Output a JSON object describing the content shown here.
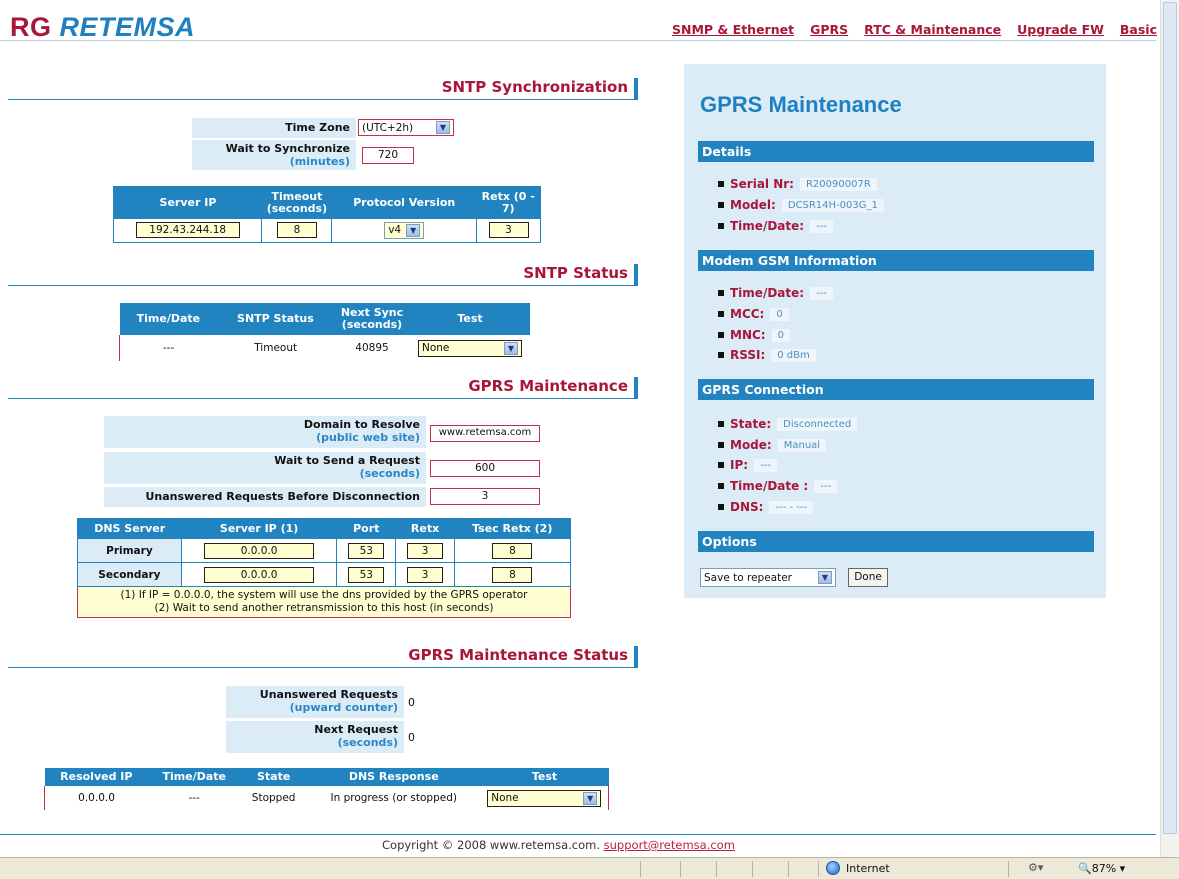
{
  "header": {
    "logo_rg": "RG",
    "logo_name": "RETEMSA",
    "nav": [
      "SNMP & Ethernet",
      "GPRS",
      "RTC & Maintenance",
      "Upgrade FW",
      "Basic"
    ]
  },
  "sntp": {
    "title": "SNTP Synchronization",
    "time_zone_label": "Time Zone",
    "time_zone_value": "(UTC+2h)",
    "wait_label": "Wait to Synchronize",
    "wait_sub": "(minutes)",
    "wait_value": "720",
    "table_headers": [
      "Server IP",
      "Timeout (seconds)",
      "Protocol Version",
      "Retx (0 - 7)"
    ],
    "server_ip": "192.43.244.18",
    "timeout": "8",
    "protocol": "v4",
    "retx": "3"
  },
  "sntp_status": {
    "title": "SNTP Status",
    "headers": [
      "Time/Date",
      "SNTP Status",
      "Next Sync (seconds)",
      "Test"
    ],
    "time_date": "---",
    "status": "Timeout",
    "next_sync": "40895",
    "test": "None"
  },
  "gprs_maint": {
    "title": "GPRS Maintenance",
    "domain_label": "Domain to Resolve",
    "domain_sub": "(public web site)",
    "domain_value": "www.retemsa.com",
    "wait_req_label": "Wait to Send a Request",
    "wait_req_sub": "(seconds)",
    "wait_req_value": "600",
    "unans_label": "Unanswered Requests Before Disconnection",
    "unans_value": "3",
    "dns_headers": [
      "DNS Server",
      "Server IP (1)",
      "Port",
      "Retx",
      "Tsec Retx (2)"
    ],
    "dns_rows": [
      {
        "name": "Primary",
        "ip": "0.0.0.0",
        "port": "53",
        "retx": "3",
        "tsec": "8"
      },
      {
        "name": "Secondary",
        "ip": "0.0.0.0",
        "port": "53",
        "retx": "3",
        "tsec": "8"
      }
    ],
    "note1": "(1) If IP = 0.0.0.0, the system will use the dns provided by the GPRS operator",
    "note2": "(2) Wait to send another retransmission to this host (in seconds)"
  },
  "gprs_status": {
    "title": "GPRS Maintenance Status",
    "unans_label": "Unanswered Requests",
    "unans_sub": "(upward counter)",
    "unans_value": "0",
    "next_label": "Next Request",
    "next_sub": "(seconds)",
    "next_value": "0",
    "headers": [
      "Resolved IP",
      "Time/Date",
      "State",
      "DNS Response",
      "Test"
    ],
    "resolved_ip": "0.0.0.0",
    "time_date": "---",
    "state": "Stopped",
    "dns_response": "In progress (or stopped)",
    "test": "None"
  },
  "panel": {
    "title": "GPRS Maintenance",
    "details_title": "Details",
    "details": [
      {
        "k": "Serial Nr:",
        "v": "R20090007R"
      },
      {
        "k": "Model:",
        "v": "DCSR14H-003G_1"
      },
      {
        "k": "Time/Date:",
        "v": "---"
      }
    ],
    "modem_title": "Modem GSM Information",
    "modem": [
      {
        "k": "Time/Date:",
        "v": "---"
      },
      {
        "k": "MCC:",
        "v": "0"
      },
      {
        "k": "MNC:",
        "v": "0"
      },
      {
        "k": "RSSI:",
        "v": "0 dBm"
      }
    ],
    "conn_title": "GPRS Connection",
    "conn": [
      {
        "k": "State:",
        "v": "Disconnected"
      },
      {
        "k": "Mode:",
        "v": "Manual"
      },
      {
        "k": "IP:",
        "v": "---"
      },
      {
        "k": "Time/Date :",
        "v": "---"
      },
      {
        "k": "DNS:",
        "v": "--- - ---"
      }
    ],
    "options_title": "Options",
    "options_select": "Save to repeater",
    "done_label": "Done"
  },
  "footer": {
    "copyright": "Copyright © 2008 www.retemsa.com.",
    "email": "support@retemsa.com"
  },
  "statusbar": {
    "zone": "Internet",
    "zoom": "87%"
  }
}
